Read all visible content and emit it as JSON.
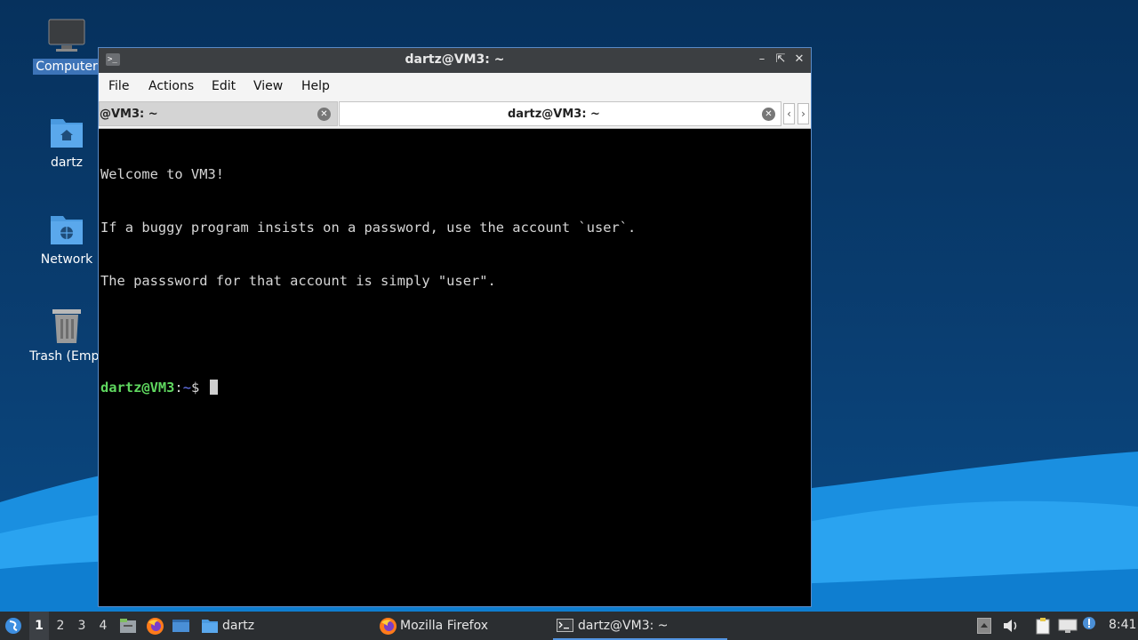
{
  "desktop": {
    "icons": [
      {
        "label": "Computer",
        "icon": "computer-icon"
      },
      {
        "label": "dartz",
        "icon": "home-folder-icon"
      },
      {
        "label": "Network",
        "icon": "network-folder-icon"
      },
      {
        "label": "Trash (Empt",
        "icon": "trash-icon"
      }
    ]
  },
  "window": {
    "title": "dartz@VM3: ~",
    "menu": [
      "File",
      "Actions",
      "Edit",
      "View",
      "Help"
    ],
    "tabs": [
      {
        "label": "@VM3: ~",
        "active": false
      },
      {
        "label": "dartz@VM3: ~",
        "active": true
      }
    ],
    "terminal": {
      "lines": [
        "Welcome to VM3!",
        "If a buggy program insists on a password, use the account `user`.",
        "The passsword for that account is simply \"user\"."
      ],
      "prompt_user": "dartz@VM3",
      "prompt_sep": ":",
      "prompt_dir": "~",
      "prompt_symbol": "$ "
    }
  },
  "taskbar": {
    "workspaces": [
      "1",
      "2",
      "3",
      "4"
    ],
    "active_workspace": "1",
    "tasks": [
      {
        "label": "dartz",
        "icon": "folder-icon"
      },
      {
        "label": "Mozilla Firefox",
        "icon": "firefox-icon"
      },
      {
        "label": "dartz@VM3: ~",
        "icon": "terminal-icon"
      }
    ],
    "clock": "8:41"
  },
  "colors": {
    "accent": "#5294e2",
    "prompt_user": "#5fd75f",
    "prompt_dir": "#6c7cff"
  }
}
